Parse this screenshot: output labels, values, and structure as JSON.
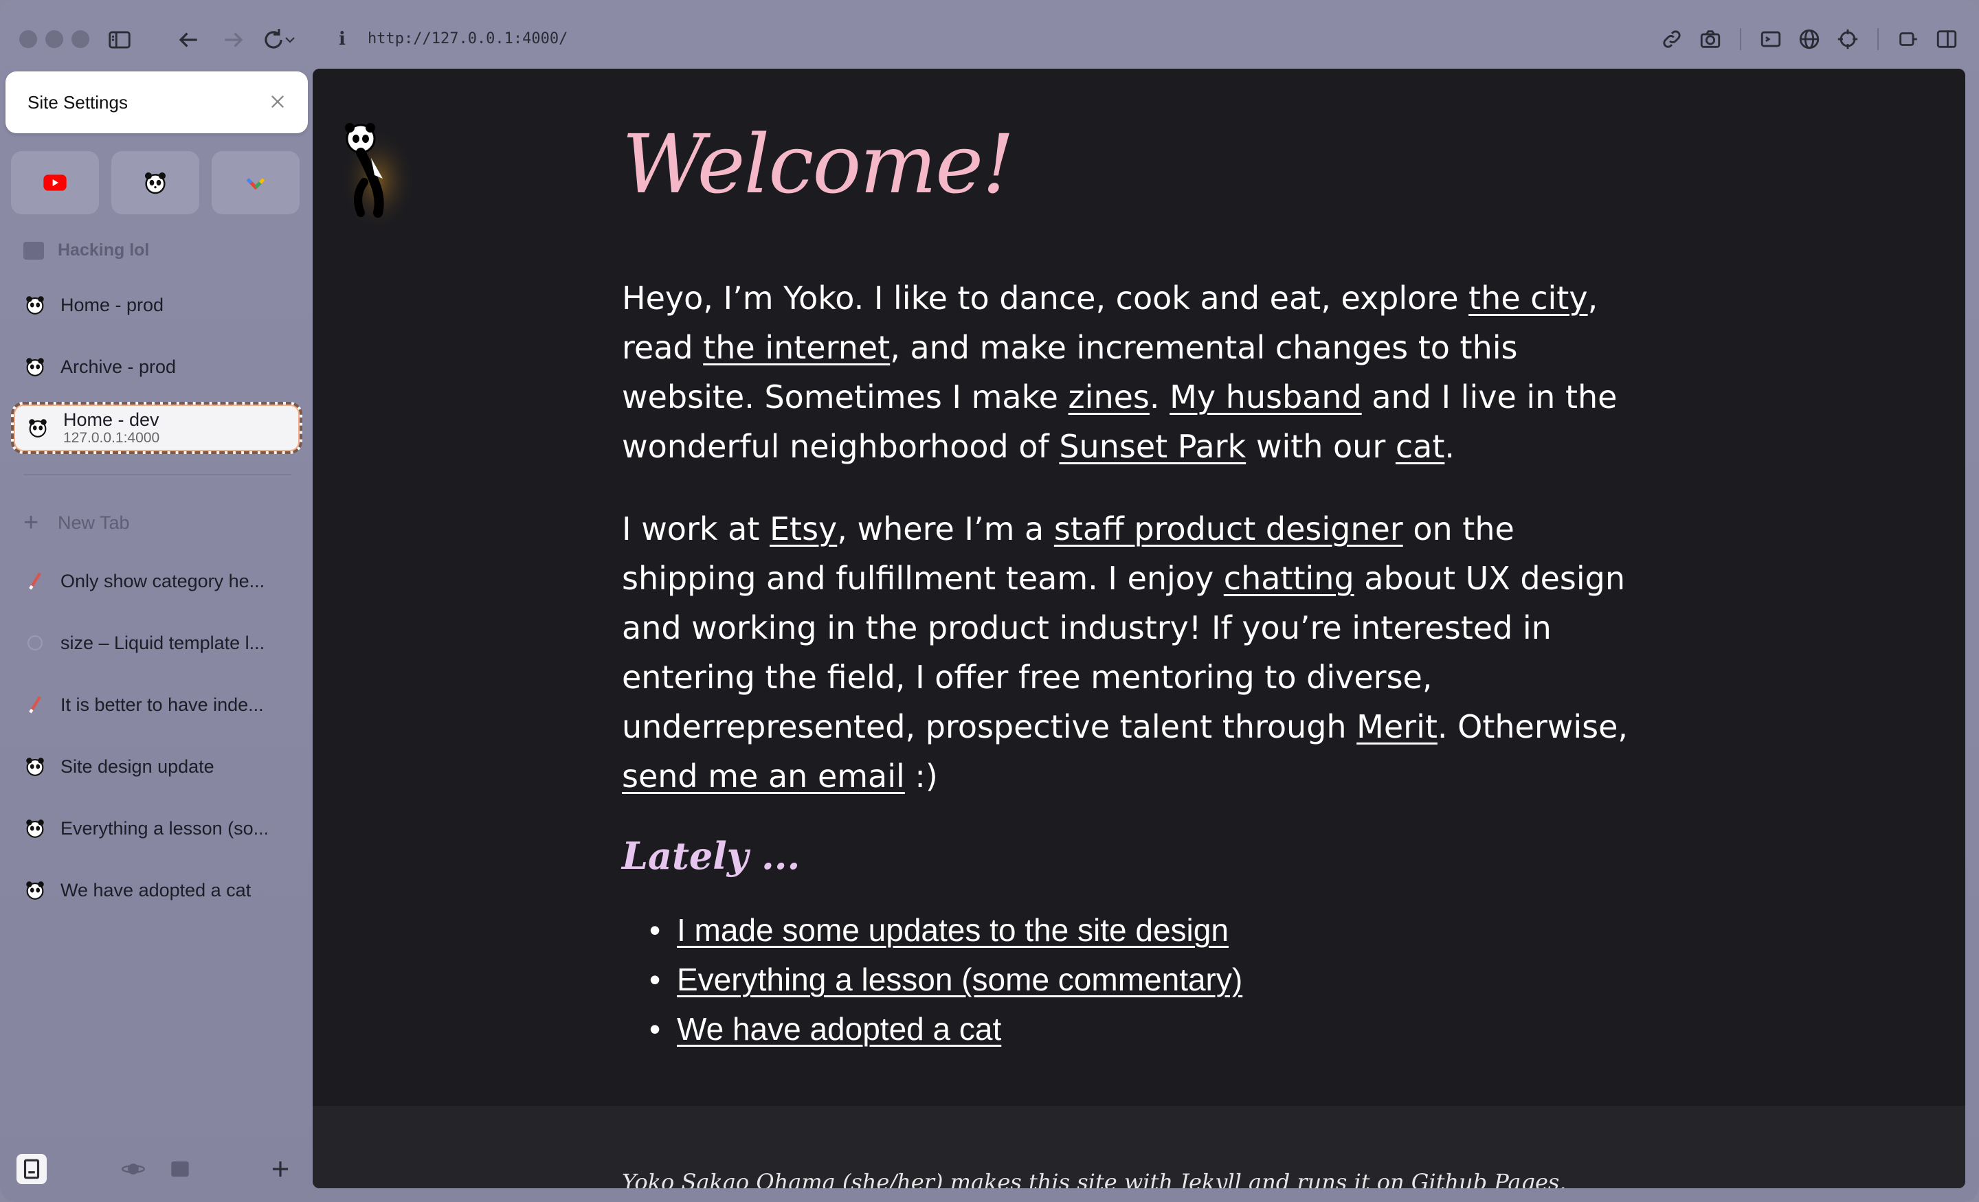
{
  "sidebar": {
    "site_settings_label": "Site Settings",
    "folder_label": "Hacking lol",
    "tabs": [
      {
        "title": "Home - prod",
        "icon": "panda-icon"
      },
      {
        "title": "Archive - prod",
        "icon": "panda-icon"
      },
      {
        "title": "Home - dev",
        "subtitle": "127.0.0.1:4000",
        "icon": "panda-icon",
        "active": true
      }
    ],
    "new_tab_label": "New Tab",
    "more_tabs": [
      {
        "title": "Only show category he...",
        "icon": "pen-icon"
      },
      {
        "title": "size – Liquid template l...",
        "icon": "blank-icon"
      },
      {
        "title": "It is better to have inde...",
        "icon": "pen-icon"
      },
      {
        "title": "Site design update",
        "icon": "panda-icon"
      },
      {
        "title": "Everything a lesson (so...",
        "icon": "panda-icon"
      },
      {
        "title": "We have adopted a cat",
        "icon": "panda-icon"
      }
    ]
  },
  "toolbar": {
    "info_icon_label": "i",
    "url": "http://127.0.0.1:4000/"
  },
  "page": {
    "heading": "Welcome!",
    "p1": {
      "t1": "Heyo, I’m Yoko. I like to dance, cook and eat, explore ",
      "l1": "the city",
      "t2": ", read ",
      "l2": "the internet",
      "t3": ", and make incremental changes to this website. Sometimes I make ",
      "l3": "zines",
      "t4": ". ",
      "l4": "My husband",
      "t5": " and I live in the wonderful neighborhood of ",
      "l5": "Sunset Park",
      "t6": " with our ",
      "l6": "cat",
      "t7": "."
    },
    "p2": {
      "t1": "I work at ",
      "l1": "Etsy",
      "t2": ", where I’m a ",
      "l2": "staff product designer",
      "t3": " on the shipping and fulfillment team. I enjoy ",
      "l3": "chatting",
      "t4": " about UX design and working in the product industry! If you’re interested in entering the field, I offer free mentoring to diverse, underrepresented, prospective talent through ",
      "l4": "Merit",
      "t5": ". Otherwise, ",
      "l5": "send me an email",
      "t6": " :)"
    },
    "lately_heading": "Lately ...",
    "posts": [
      "I made some updates to the site design",
      "Everything a lesson (some commentary)",
      "We have adopted a cat"
    ],
    "footer": "Yoko Sakao Ohama (she/her) makes this site with Jekyll and runs it on Github Pages."
  },
  "colors": {
    "sidebar_bg": "#8a8aa3",
    "page_bg": "#1c1b1f",
    "heading": "#f4b8c8",
    "lately": "#e6c6ee",
    "active_tab_border": "#7a5a4a"
  }
}
